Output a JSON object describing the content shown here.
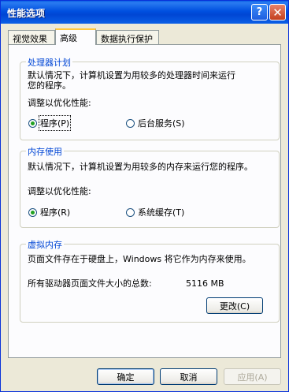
{
  "window": {
    "title": "性能选项",
    "help_glyph": "?",
    "close_glyph": "✕"
  },
  "tabs": [
    {
      "label": "视觉效果"
    },
    {
      "label": "高级"
    },
    {
      "label": "数据执行保护"
    }
  ],
  "processor": {
    "title": "处理器计划",
    "desc_line1": "默认情况下，计算机设置为用较多的处理器时间来运行",
    "desc_line2": "您的程序。",
    "adjust_label": "调整以优化性能:",
    "option_programs": "程序(P)",
    "option_services": "后台服务(S)",
    "selected": "programs"
  },
  "memory": {
    "title": "内存使用",
    "desc_line1": "默认情况下，计算机设置为用较多的内存来运行您的程序。",
    "adjust_label": "调整以优化性能:",
    "option_programs": "程序(R)",
    "option_cache": "系统缓存(T)",
    "selected": "programs"
  },
  "virtual_memory": {
    "title": "虚拟内存",
    "desc": "页面文件存在于硬盘上，Windows 将它作为内存来使用。",
    "total_label": "所有驱动器页面文件大小的总数:",
    "total_value": "5116 MB",
    "change_button": "更改(C)"
  },
  "footer": {
    "ok": "确定",
    "cancel": "取消",
    "apply": "应用(A)"
  }
}
